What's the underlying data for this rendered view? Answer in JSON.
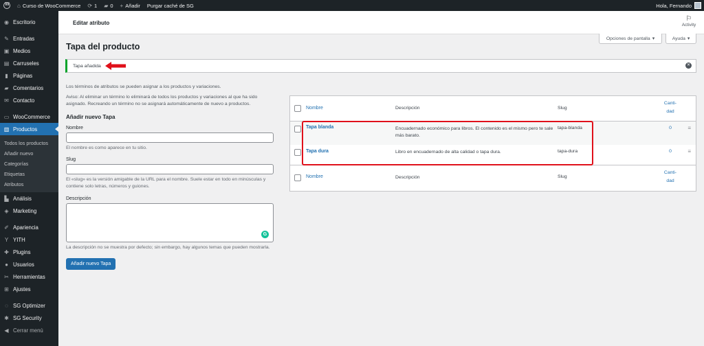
{
  "adminbar": {
    "site_name": "Curso de WooCommerce",
    "updates": "1",
    "comments": "0",
    "new_label": "Añadir",
    "purge_label": "Purgar caché de SG",
    "greeting": "Hola, Fernando"
  },
  "sidebar": {
    "items": [
      {
        "label": "Escritorio",
        "icon": "dashboard-icon"
      },
      {
        "label": "Entradas",
        "icon": "pin-icon"
      },
      {
        "label": "Medios",
        "icon": "media-icon"
      },
      {
        "label": "Carruseles",
        "icon": "carousel-icon"
      },
      {
        "label": "Páginas",
        "icon": "pages-icon"
      },
      {
        "label": "Comentarios",
        "icon": "comments-icon"
      },
      {
        "label": "Contacto",
        "icon": "mail-icon"
      },
      {
        "label": "WooCommerce",
        "icon": "woo-icon"
      },
      {
        "label": "Productos",
        "icon": "products-icon"
      }
    ],
    "submenu": [
      "Todos los productos",
      "Añadir nuevo",
      "Categorías",
      "Etiquetas",
      "Atributos"
    ],
    "items2": [
      {
        "label": "Análisis",
        "icon": "analytics-icon"
      },
      {
        "label": "Marketing",
        "icon": "marketing-icon"
      },
      {
        "label": "Apariencia",
        "icon": "appearance-icon"
      },
      {
        "label": "YITH",
        "icon": "yith-icon"
      },
      {
        "label": "Plugins",
        "icon": "plugins-icon"
      },
      {
        "label": "Usuarios",
        "icon": "users-icon"
      },
      {
        "label": "Herramientas",
        "icon": "tools-icon"
      },
      {
        "label": "Ajustes",
        "icon": "settings-icon"
      },
      {
        "label": "SG Optimizer",
        "icon": "sg-optimizer-icon"
      },
      {
        "label": "SG Security",
        "icon": "sg-security-icon"
      },
      {
        "label": "Cerrar menú",
        "icon": "collapse-icon"
      }
    ]
  },
  "header": {
    "title": "Editar atributo",
    "activity": "Activity"
  },
  "screen_options": "Opciones de pantalla",
  "help": "Ayuda",
  "page_title": "Tapa del producto",
  "notice": "Tapa añadida",
  "left": {
    "intro": "Los términos de atributos se pueden asignar a los productos y variaciones.",
    "warning": "Aviso: Al eliminar un término lo eliminará de todos los productos y variaciones al que ha sido asignado. Recreando un término no se asignará automáticamente de nuevo a productos.",
    "form_title": "Añadir nuevo Tapa",
    "name_label": "Nombre",
    "name_help": "El nombre es como aparece en tu sitio.",
    "slug_label": "Slug",
    "slug_help": "El «slug» es la versión amigable de la URL para el nombre. Suele estar en todo en minúsculas y contiene solo letras, números y guiones.",
    "desc_label": "Descripción",
    "desc_help": "La descripción no se muestra por defecto; sin embargo, hay algunos temas que pueden mostrarla.",
    "submit": "Añadir nuevo Tapa"
  },
  "table": {
    "col_name": "Nombre",
    "col_desc": "Descripción",
    "col_slug": "Slug",
    "col_count_1": "Canti-",
    "col_count_2": "dad",
    "rows": [
      {
        "name": "Tapa blanda",
        "desc": "Encuadernado económico para libros. El contenido es el mismo pero te sale más barato.",
        "slug": "tapa-blanda",
        "count": "0"
      },
      {
        "name": "Tapa dura",
        "desc": "Libro en encuadernado de alta calidad o tapa dura.",
        "slug": "tapa-dura",
        "count": "0"
      }
    ]
  }
}
